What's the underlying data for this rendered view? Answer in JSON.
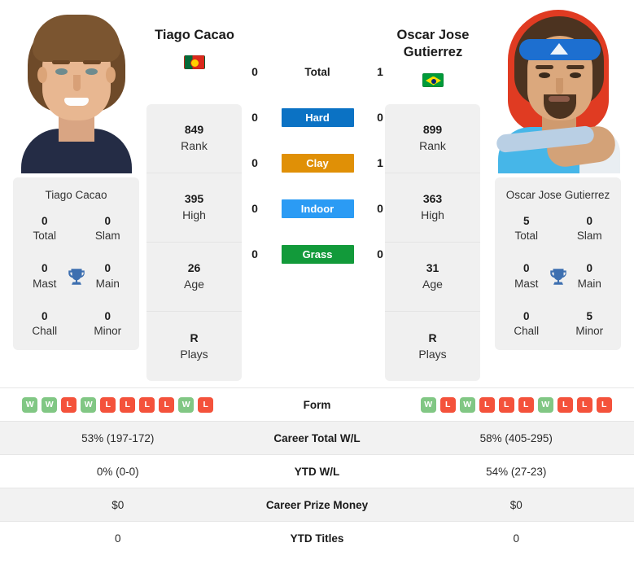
{
  "players": {
    "left": {
      "name": "Tiago Cacao",
      "flag": "pt",
      "flag_name": "portugal-flag",
      "card_name": "Tiago Cacao",
      "stats": [
        {
          "value": "849",
          "label": "Rank"
        },
        {
          "value": "395",
          "label": "High"
        },
        {
          "value": "26",
          "label": "Age"
        },
        {
          "value": "R",
          "label": "Plays"
        }
      ],
      "titles": [
        {
          "value": "0",
          "label": "Total"
        },
        {
          "value": "0",
          "label": "Slam"
        },
        {
          "value": "0",
          "label": "Mast"
        },
        {
          "value": "0",
          "label": "Main"
        },
        {
          "value": "0",
          "label": "Chall"
        },
        {
          "value": "0",
          "label": "Minor"
        }
      ],
      "form": [
        "W",
        "W",
        "L",
        "W",
        "L",
        "L",
        "L",
        "L",
        "W",
        "L"
      ]
    },
    "right": {
      "name": "Oscar Jose Gutierrez",
      "flag": "br",
      "flag_name": "brazil-flag",
      "card_name": "Oscar Jose Gutierrez",
      "stats": [
        {
          "value": "899",
          "label": "Rank"
        },
        {
          "value": "363",
          "label": "High"
        },
        {
          "value": "31",
          "label": "Age"
        },
        {
          "value": "R",
          "label": "Plays"
        }
      ],
      "titles": [
        {
          "value": "5",
          "label": "Total"
        },
        {
          "value": "0",
          "label": "Slam"
        },
        {
          "value": "0",
          "label": "Mast"
        },
        {
          "value": "0",
          "label": "Main"
        },
        {
          "value": "0",
          "label": "Chall"
        },
        {
          "value": "5",
          "label": "Minor"
        }
      ],
      "form": [
        "W",
        "L",
        "W",
        "L",
        "L",
        "L",
        "W",
        "L",
        "L",
        "L"
      ]
    }
  },
  "h2h": [
    {
      "label": "Total",
      "left": "0",
      "right": "1",
      "badge": false,
      "color": ""
    },
    {
      "label": "Hard",
      "left": "0",
      "right": "0",
      "badge": true,
      "color": "#0b72c4"
    },
    {
      "label": "Clay",
      "left": "0",
      "right": "1",
      "badge": true,
      "color": "#e09006"
    },
    {
      "label": "Indoor",
      "left": "0",
      "right": "0",
      "badge": true,
      "color": "#2b9bf4"
    },
    {
      "label": "Grass",
      "left": "0",
      "right": "0",
      "badge": true,
      "color": "#129a3a"
    }
  ],
  "table": {
    "form_label": "Form",
    "rows": [
      {
        "label": "Career Total W/L",
        "left": "53% (197-172)",
        "right": "58% (405-295)"
      },
      {
        "label": "YTD W/L",
        "left": "0% (0-0)",
        "right": "54% (27-23)"
      },
      {
        "label": "Career Prize Money",
        "left": "$0",
        "right": "$0"
      },
      {
        "label": "YTD Titles",
        "left": "0",
        "right": "0"
      }
    ]
  },
  "colors": {
    "win": "#81c784",
    "loss": "#f4523b",
    "trophy": "#3d6fb0",
    "card_bg": "#f0f0f0",
    "row_alt": "#f2f2f2"
  }
}
